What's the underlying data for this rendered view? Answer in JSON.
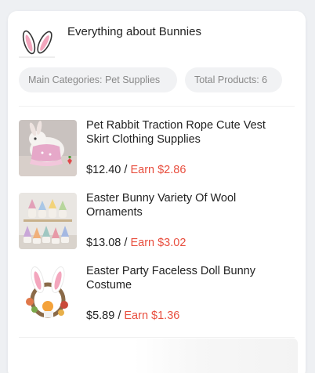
{
  "header": {
    "title": "Everything about Bunnies",
    "icon": "bunny-ears-icon"
  },
  "chips": {
    "category": "Main Categories: Pet Supplies",
    "total": "Total Products: 6"
  },
  "colors": {
    "earn": "#e84e3e",
    "chip_bg": "#f1f2f4",
    "ear_pink": "#f3a6bd"
  },
  "products": [
    {
      "name": "Pet Rabbit Traction Rope Cute Vest Skirt Clothing Supplies",
      "price": "$12.40",
      "separator": "/",
      "earn": "Earn $2.86",
      "image": "rabbit-vest-photo"
    },
    {
      "name": "Easter Bunny Variety Of Wool Ornaments",
      "price": "$13.08",
      "separator": "/",
      "earn": "Earn $3.02",
      "image": "wool-ornaments-photo"
    },
    {
      "name": "Easter Party Faceless Doll Bunny Costume",
      "price": "$5.89",
      "separator": "/",
      "earn": "Earn $1.36",
      "image": "bunny-costume-photo"
    }
  ]
}
